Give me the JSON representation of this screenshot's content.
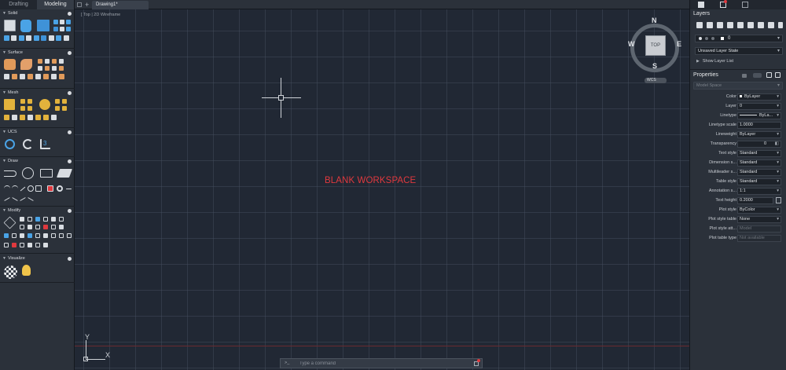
{
  "left_panel": {
    "tabs": [
      "Drafting",
      "Modeling"
    ],
    "sections": [
      "Solid",
      "Surface",
      "Mesh",
      "UCS",
      "Draw",
      "Modify",
      "Visualize"
    ]
  },
  "document": {
    "tab_title": "Drawing1*",
    "view_label": "[ Top | 2D Wireframe"
  },
  "canvas": {
    "workspace_label": "BLANK WORKSPACE",
    "ucs_y": "Y",
    "ucs_x": "X",
    "viewcube": {
      "top": "TOP",
      "n": "N",
      "s": "S",
      "e": "E",
      "w": "W",
      "wcs": "WCS"
    }
  },
  "command": {
    "prompt": ">_",
    "placeholder": "Type a command"
  },
  "layers_panel": {
    "title": "Layers",
    "current_layer": "0",
    "layer_state": "Unsaved Layer State",
    "show_list": "Show Layer List"
  },
  "properties_panel": {
    "title": "Properties",
    "space": "Model Space",
    "rows": [
      {
        "label": "Color",
        "value": "ByLayer"
      },
      {
        "label": "Layer",
        "value": "0"
      },
      {
        "label": "Linetype",
        "value": "ByLa..."
      },
      {
        "label": "Linetype scale",
        "value": "1.0000"
      },
      {
        "label": "Lineweight",
        "value": "ByLayer"
      },
      {
        "label": "Transparency",
        "value": "0"
      },
      {
        "label": "Text style",
        "value": "Standard"
      },
      {
        "label": "Dimension s...",
        "value": "Standard"
      },
      {
        "label": "Multileader s...",
        "value": "Standard"
      },
      {
        "label": "Table style",
        "value": "Standard"
      },
      {
        "label": "Annotation s...",
        "value": "1:1"
      },
      {
        "label": "Text height",
        "value": "0.2000"
      },
      {
        "label": "Plot style",
        "value": "ByColor"
      },
      {
        "label": "Plot style table",
        "value": "None"
      },
      {
        "label": "Plot style att...",
        "value": "Model"
      },
      {
        "label": "Plot table type",
        "value": "Not available"
      }
    ]
  },
  "colors": {
    "workspace_label": "#e0393e",
    "canvas_bg": "#212834",
    "panel_bg": "#2b313a"
  }
}
